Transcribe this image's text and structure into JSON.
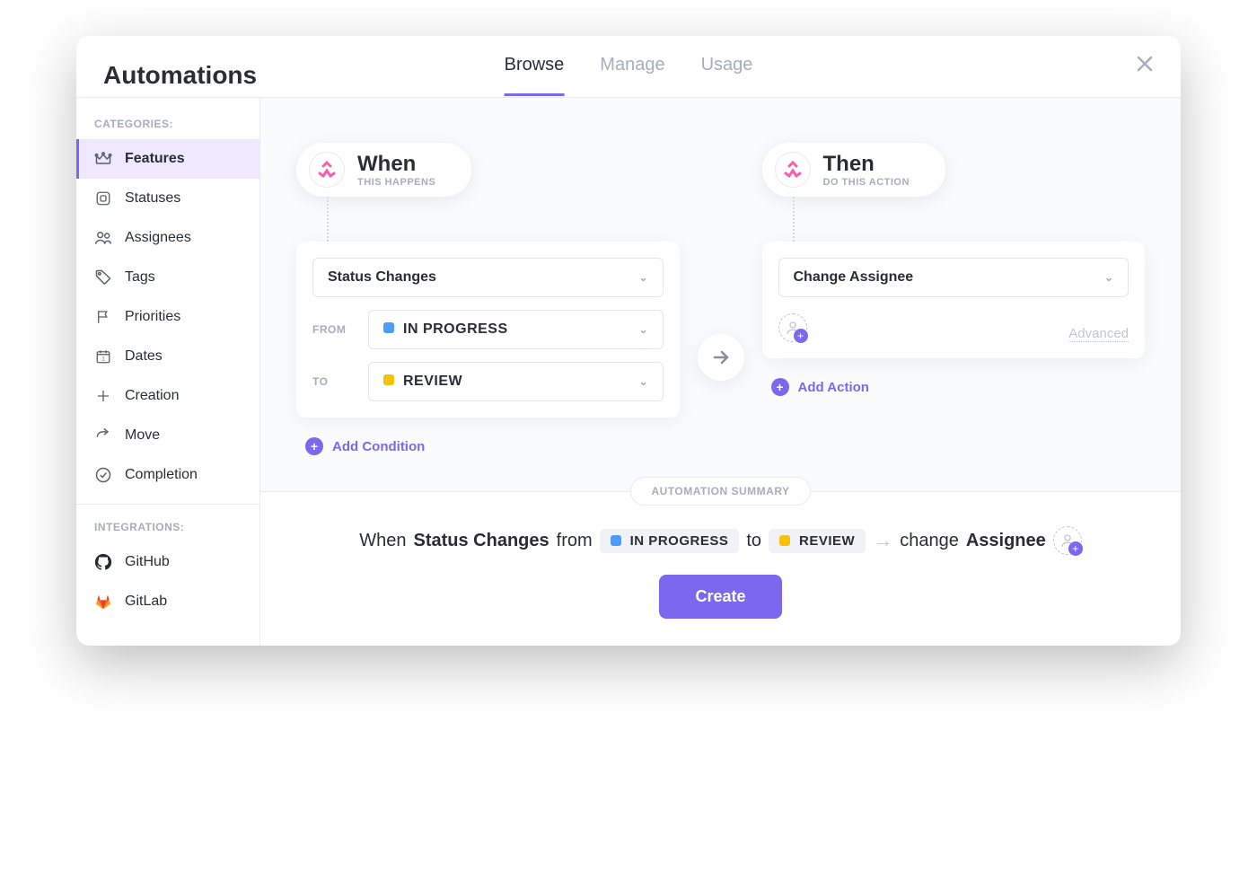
{
  "header": {
    "title": "Automations",
    "tabs": [
      "Browse",
      "Manage",
      "Usage"
    ],
    "active_tab": 0
  },
  "sidebar": {
    "categories_label": "CATEGORIES:",
    "integrations_label": "INTEGRATIONS:",
    "categories": [
      {
        "label": "Features",
        "icon": "crown-icon"
      },
      {
        "label": "Statuses",
        "icon": "square-icon"
      },
      {
        "label": "Assignees",
        "icon": "people-icon"
      },
      {
        "label": "Tags",
        "icon": "tag-icon"
      },
      {
        "label": "Priorities",
        "icon": "flag-icon"
      },
      {
        "label": "Dates",
        "icon": "calendar-icon"
      },
      {
        "label": "Creation",
        "icon": "plus-icon"
      },
      {
        "label": "Move",
        "icon": "share-icon"
      },
      {
        "label": "Completion",
        "icon": "check-circle-icon"
      }
    ],
    "integrations": [
      {
        "label": "GitHub",
        "icon": "github-icon"
      },
      {
        "label": "GitLab",
        "icon": "gitlab-icon"
      }
    ],
    "active_category": 0
  },
  "when": {
    "title": "When",
    "subtitle": "THIS HAPPENS",
    "trigger": "Status Changes",
    "from_label": "FROM",
    "to_label": "TO",
    "from_status": "IN PROGRESS",
    "from_color": "#4b9cfd",
    "to_status": "REVIEW",
    "to_color": "#f5c10a",
    "add_condition": "Add Condition"
  },
  "then": {
    "title": "Then",
    "subtitle": "DO THIS ACTION",
    "action": "Change Assignee",
    "advanced": "Advanced",
    "add_action": "Add Action"
  },
  "summary": {
    "label": "AUTOMATION SUMMARY",
    "when_word": "When",
    "trigger": "Status Changes",
    "from_word": "from",
    "from_status": "IN PROGRESS",
    "from_color": "#4b9cfd",
    "to_word": "to",
    "to_status": "REVIEW",
    "to_color": "#f5c10a",
    "change_word": "change",
    "target": "Assignee",
    "create_button": "Create"
  }
}
